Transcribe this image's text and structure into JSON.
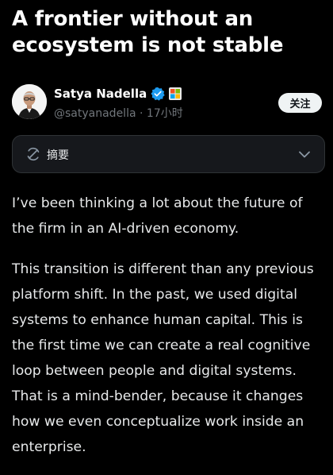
{
  "article": {
    "title": "A frontier without an ecosystem is not stable",
    "paragraphs": [
      "I’ve been thinking a lot about the future of the firm in an AI-driven economy.",
      "This transition is different than any previous platform shift. In the past, we used digital systems to enhance human capital. This is the first time we can create a real cognitive loop between people and digital systems. That is a mind-bender, because it changes how we even conceptualize work inside an enterprise."
    ]
  },
  "author": {
    "name": "Satya Nadella",
    "handle": "@satyanadella",
    "separator": "·",
    "time": "17小时",
    "verified_icon": "verified-badge-icon",
    "affiliation_icon": "microsoft-logo-icon"
  },
  "actions": {
    "follow_label": "关注"
  },
  "summary": {
    "label": "摘要",
    "icon": "ai-summary-icon",
    "toggle_icon": "chevron-down-icon"
  },
  "colors": {
    "background": "#000000",
    "text_primary": "#ffffff",
    "text_secondary": "#71767b",
    "verified_blue": "#1d9bf0",
    "button_bg": "#eff3f4"
  }
}
